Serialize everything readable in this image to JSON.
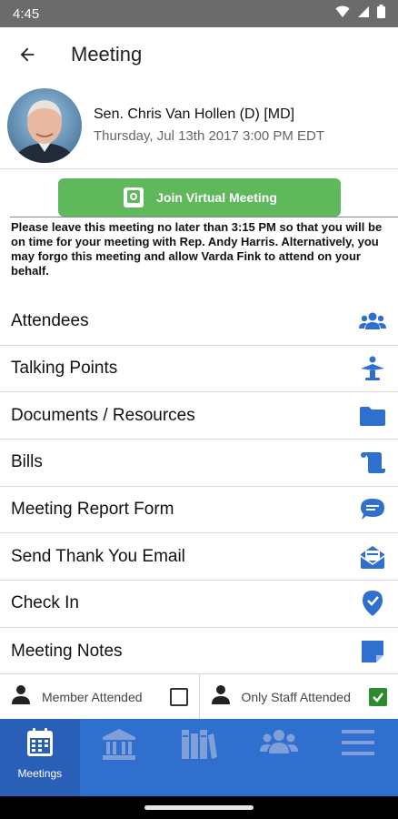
{
  "status_bar": {
    "time": "4:45"
  },
  "app_bar": {
    "title": "Meeting"
  },
  "host": {
    "name": "Sen. Chris Van Hollen (D) [MD]",
    "datetime": "Thursday, Jul 13th 2017 3:00 PM EDT"
  },
  "join": {
    "label": "Join Virtual Meeting",
    "color": "#5fb85b"
  },
  "notice": "Please leave this meeting no later than 3:15 PM so that you will be on time for your meeting with Rep. Andy Harris. Alternatively, you may forgo this meeting and allow Varda Fink to attend on your behalf.",
  "menu": {
    "items": [
      {
        "label": "Attendees",
        "icon": "users-icon"
      },
      {
        "label": "Talking Points",
        "icon": "podium-icon"
      },
      {
        "label": "Documents / Resources",
        "icon": "folder-icon"
      },
      {
        "label": "Bills",
        "icon": "scroll-icon"
      },
      {
        "label": "Meeting Report Form",
        "icon": "chat-bubble-icon"
      },
      {
        "label": "Send Thank You Email",
        "icon": "envelope-open-icon"
      },
      {
        "label": "Check In",
        "icon": "location-check-icon"
      },
      {
        "label": "Meeting Notes",
        "icon": "sticky-note-icon"
      }
    ],
    "icon_color": "#2f6fce"
  },
  "attendance": {
    "member_label": "Member Attended",
    "member_checked": false,
    "staff_label": "Only Staff Attended",
    "staff_checked": true
  },
  "bottom_nav": {
    "items": [
      {
        "label": "Meetings",
        "icon": "calendar-icon",
        "active": true
      },
      {
        "label": "",
        "icon": "capitol-icon",
        "active": false
      },
      {
        "label": "",
        "icon": "books-icon",
        "active": false
      },
      {
        "label": "",
        "icon": "group-icon",
        "active": false
      },
      {
        "label": "",
        "icon": "hamburger-menu-icon",
        "active": false
      }
    ],
    "background": "#2f6fce"
  }
}
